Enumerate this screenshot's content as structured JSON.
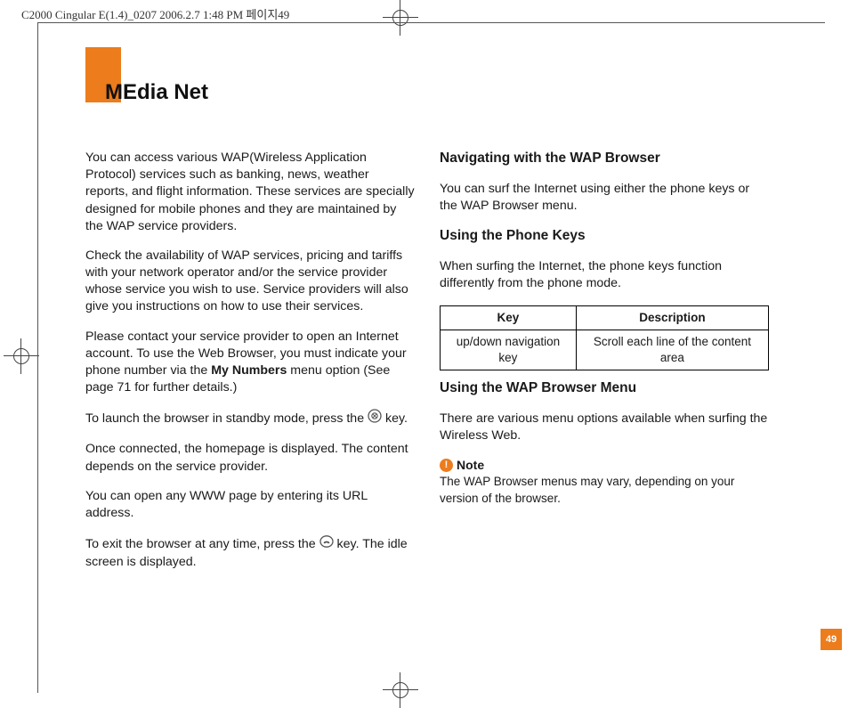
{
  "crop_header": "C2000 Cingular E(1.4)_0207  2006.2.7 1:48 PM  페이지49",
  "title": "MEdia Net",
  "page_number": "49",
  "left_column": {
    "p1": "You can access various WAP(Wireless Application Protocol) services such as banking, news, weather reports, and flight information. These services are specially designed for mobile phones and they are maintained by the WAP service providers.",
    "p2": "Check the availability of WAP services, pricing and tariffs with your network operator and/or the service provider whose service you wish to use. Service providers will also give you instructions on how to use their services.",
    "p3a": "Please contact your service provider to open an Internet account. To use the Web Browser, you must indicate your phone number via the ",
    "p3bold": "My Numbers",
    "p3b": " menu option (See page 71 for further details.)",
    "p4a": "To launch the browser in standby mode, press the ",
    "p4b": " key.",
    "p5": "Once connected, the homepage is displayed. The content depends on the service provider.",
    "p6": "You can open any WWW page by entering its URL address.",
    "p7a": "To exit the browser at any time, press the ",
    "p7b": " key. The idle screen is displayed."
  },
  "right_column": {
    "h1": "Navigating with the WAP Browser",
    "p1": "You can surf the Internet using either the phone keys or the WAP Browser menu.",
    "h2": "Using the Phone Keys",
    "p2": "When surfing the Internet, the phone keys function differently from the phone mode.",
    "table": {
      "head_key": "Key",
      "head_desc": "Description",
      "row1_key": "up/down navigation key",
      "row1_desc": "Scroll each line of the content area"
    },
    "h3": "Using the WAP Browser Menu",
    "p3": "There are various menu options available when surfing the Wireless Web.",
    "note_label": "Note",
    "note_text": "The WAP Browser menus may vary, depending on your version of the browser."
  }
}
